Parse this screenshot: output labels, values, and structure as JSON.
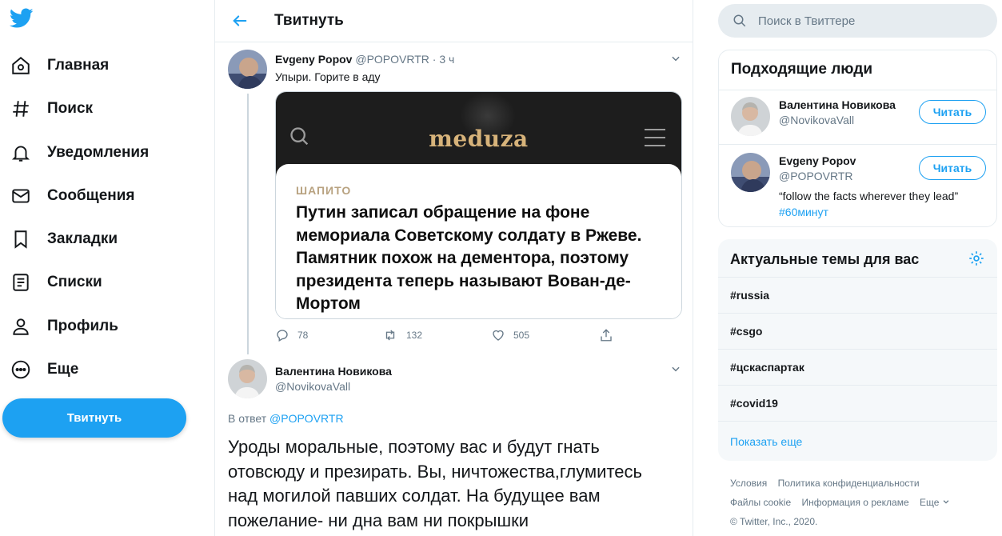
{
  "nav": {
    "items": [
      {
        "label": "Главная",
        "icon": "home-icon"
      },
      {
        "label": "Поиск",
        "icon": "hashtag-icon"
      },
      {
        "label": "Уведомления",
        "icon": "bell-icon"
      },
      {
        "label": "Сообщения",
        "icon": "envelope-icon"
      },
      {
        "label": "Закладки",
        "icon": "bookmark-icon"
      },
      {
        "label": "Списки",
        "icon": "list-icon"
      },
      {
        "label": "Профиль",
        "icon": "person-icon"
      },
      {
        "label": "Еще",
        "icon": "more-icon"
      }
    ],
    "tweet_button": "Твитнуть"
  },
  "header": {
    "title": "Твитнуть"
  },
  "tweet1": {
    "name": "Evgeny Popov",
    "handle": "@POPOVRTR",
    "time": "· 3 ч",
    "text": "Упыри. Горите в аду",
    "card": {
      "brand": "meduza",
      "kicker": "ШАПИТО",
      "headline": "Путин записал обращение на фоне мемориала Советскому солдату в Ржеве. Памятник похож на дементора, поэтому президента теперь называют Вован-де-Мортом"
    },
    "stats": {
      "replies": "78",
      "retweets": "132",
      "likes": "505"
    }
  },
  "tweet2": {
    "name": "Валентина Новикова",
    "handle": "@NovikovaVall",
    "reply_prefix": "В ответ",
    "reply_to": "@POPOVRTR",
    "text": "Уроды моральные, поэтому вас и будут гнать отовсюду и презирать. Вы, ничтожества,глумитесь над могилой павших солдат. На будущее вам пожелание- ни дна вам ни покрышки"
  },
  "search": {
    "placeholder": "Поиск в Твиттере"
  },
  "who_to_follow": {
    "title": "Подходящие люди",
    "people": [
      {
        "name": "Валентина Новикова",
        "handle": "@NovikovaVall",
        "button": "Читать"
      },
      {
        "name": "Evgeny Popov",
        "handle": "@POPOVRTR",
        "button": "Читать",
        "bio": "“follow the facts wherever they lead”",
        "tag": "#60минут"
      }
    ]
  },
  "trends": {
    "title": "Актуальные темы для вас",
    "items": [
      "#russia",
      "#csgo",
      "#цскаспартак",
      "#covid19"
    ],
    "show_more": "Показать еще"
  },
  "footer": {
    "terms": "Условия",
    "privacy": "Политика конфиденциальности",
    "cookies": "Файлы cookie",
    "ads": "Информация о рекламе",
    "more": "Еще",
    "copyright": "© Twitter, Inc., 2020."
  },
  "colors": {
    "accent": "#1da1f2",
    "text": "#14171a",
    "secondary": "#657786",
    "border": "#e6ecf0"
  }
}
